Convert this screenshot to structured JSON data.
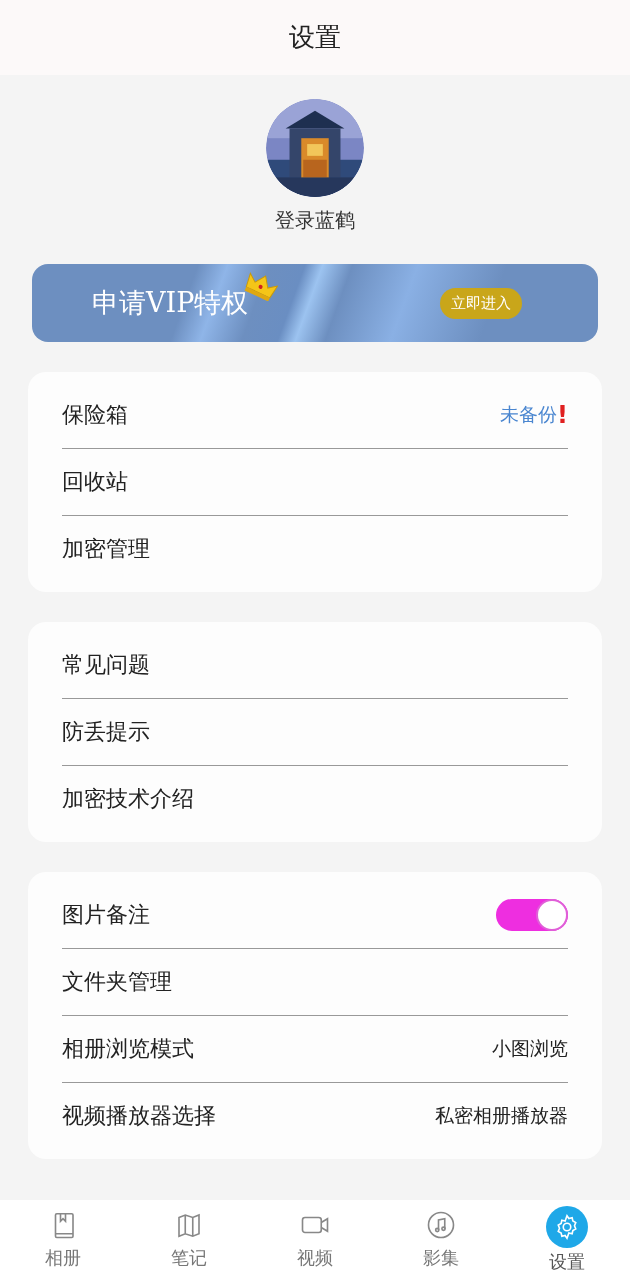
{
  "header": {
    "title": "设置"
  },
  "profile": {
    "login": "登录蓝鹤"
  },
  "vip_banner": {
    "title": "申请VIP特权",
    "button": "立即进入"
  },
  "sections": [
    {
      "rows": [
        {
          "kind": "status",
          "label": "保险箱",
          "value": "未备份",
          "alert": "!"
        },
        {
          "kind": "link",
          "label": "回收站"
        },
        {
          "kind": "link",
          "label": "加密管理"
        }
      ]
    },
    {
      "rows": [
        {
          "kind": "link",
          "label": "常见问题"
        },
        {
          "kind": "link",
          "label": "防丢提示"
        },
        {
          "kind": "link",
          "label": "加密技术介绍"
        }
      ]
    },
    {
      "rows": [
        {
          "kind": "toggle",
          "label": "图片备注",
          "on": true
        },
        {
          "kind": "link",
          "label": "文件夹管理"
        },
        {
          "kind": "value",
          "label": "相册浏览模式",
          "value": "小图浏览"
        },
        {
          "kind": "value",
          "label": "视频播放器选择",
          "value": "私密相册播放器"
        }
      ]
    }
  ],
  "tab_bar": [
    {
      "kind": "book",
      "label": "相册",
      "selected": false
    },
    {
      "kind": "map",
      "label": "笔记",
      "selected": false
    },
    {
      "kind": "video",
      "label": "视频",
      "selected": false
    },
    {
      "kind": "music",
      "label": "影集",
      "selected": false
    },
    {
      "kind": "gear",
      "label": "设置",
      "selected": true
    }
  ]
}
